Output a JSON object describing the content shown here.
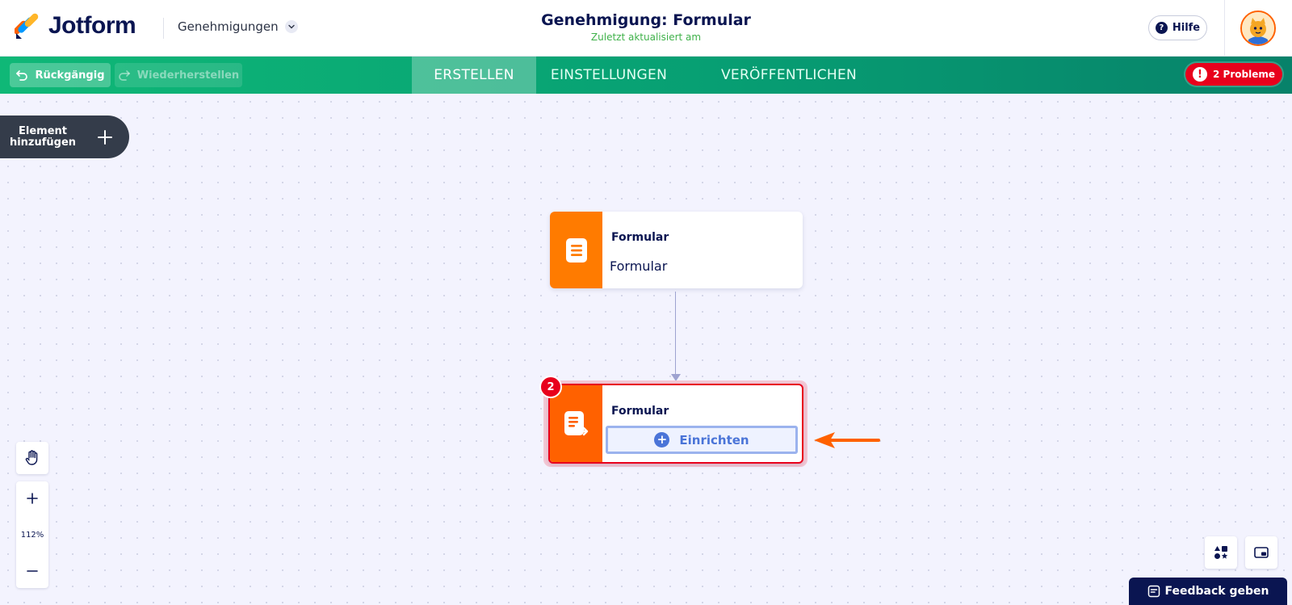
{
  "header": {
    "logo_text": "Jotform",
    "workspace_label": "Genehmigungen",
    "title": "Genehmigung: Formular",
    "subtitle": "Zuletzt aktualisiert am",
    "help_label": "Hilfe"
  },
  "toolbar": {
    "undo_label": "Rückgängig",
    "redo_label": "Wiederherstellen",
    "tabs": [
      {
        "label": "ERSTELLEN",
        "active": true
      },
      {
        "label": "EINSTELLUNGEN",
        "active": false
      },
      {
        "label": "VERÖFFENTLICHEN",
        "active": false
      }
    ],
    "problems_label": "2 Probleme"
  },
  "canvas": {
    "add_element_label": "Element hinzufügen",
    "nodes": [
      {
        "title": "Formular",
        "subtitle": "Formular",
        "icon": "form-icon",
        "color": "#ff7b00"
      },
      {
        "title": "Formular",
        "icon": "form-assign-icon",
        "color": "#ff6100",
        "badge": "2",
        "setup_label": "Einrichten",
        "state": "error"
      }
    ],
    "zoom_level": "112%"
  },
  "footer": {
    "feedback_label": "Feedback geben"
  },
  "colors": {
    "brand_navy": "#0a1551",
    "toolbar_green": "#079f73",
    "error_red": "#e8001c",
    "node_orange": "#ff7b00",
    "accent_blue": "#4a74d8",
    "annotation_arrow": "#ff6100"
  }
}
